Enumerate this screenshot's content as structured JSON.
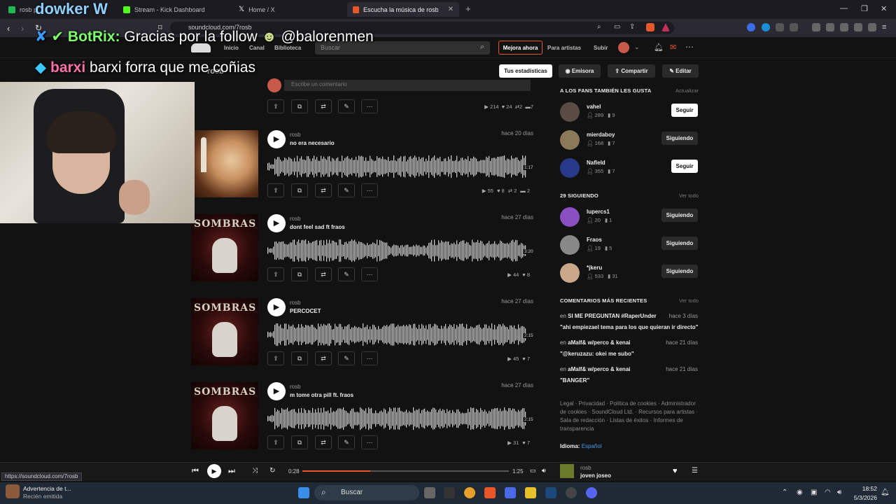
{
  "tabs": [
    {
      "label": "rosb p",
      "favicon_color": "#1db954"
    },
    {
      "label": "Stream - Kick Dashboard",
      "favicon_color": "#53fc18"
    },
    {
      "label": "Home / X",
      "favicon_color": "#ffffff"
    },
    {
      "label": "Escucha la música de rosb | Disfr",
      "favicon_color": "#e8572a"
    }
  ],
  "url": "soundcloud.com/7rosb",
  "status_url": "https://soundcloud.com/7rosb",
  "header": {
    "nav": [
      "Inicio",
      "Canal",
      "Biblioteca"
    ],
    "search_placeholder": "Buscar",
    "mejora": "Mejora ahora",
    "para_artistas": "Para artistas",
    "subir": "Subir"
  },
  "overlay": {
    "brand": "dowker W",
    "chat": [
      {
        "user": "BotRix:",
        "user_color": "#7cff6b",
        "text": " Gracias por la follow ",
        "mention": "@balorenmen"
      },
      {
        "user": "barxi",
        "user_color": "#ff6fa8",
        "text": " barxi forra que me coñias",
        "mention": ""
      }
    ]
  },
  "profile": {
    "name": "rosb",
    "actions": [
      "Tus estadísticas",
      "Emisora",
      "Compartir",
      "Editar"
    ]
  },
  "comment_placeholder": "Escribe un comentario",
  "first_row_stats": {
    "plays": "214",
    "likes": "24",
    "reposts": "2",
    "comments": "7"
  },
  "tracks": [
    {
      "user": "rosb",
      "title": "no era necesario",
      "date": "hace 20 días",
      "duration": "1:17",
      "plays": "55",
      "likes": "8",
      "reposts": "2",
      "comments": "2",
      "art": "girl"
    },
    {
      "user": "rosb",
      "title": "dont feel sad ft fraos",
      "date": "hace 27 días",
      "duration": "3:20",
      "plays": "44",
      "likes": "8",
      "reposts": "",
      "comments": "",
      "art": "sombras"
    },
    {
      "user": "rosb",
      "title": "PERCOCET",
      "date": "hace 27 días",
      "duration": "2:15",
      "plays": "45",
      "likes": "7",
      "reposts": "",
      "comments": "",
      "art": "sombras"
    },
    {
      "user": "rosb",
      "title": "m tome otra pill ft. fraos",
      "date": "hace 27 días",
      "duration": "2:15",
      "plays": "31",
      "likes": "7",
      "reposts": "",
      "comments": "",
      "art": "sombras"
    }
  ],
  "sidebar": {
    "fans_heading": "A LOS FANS TAMBIÉN LES GUSTA",
    "fans_link": "Actualizar",
    "fans": [
      {
        "name": "vahel",
        "followers": "289",
        "tracks": "9",
        "button": "Seguir",
        "color": "#5a4c44"
      },
      {
        "name": "mierdaboy",
        "followers": "168",
        "tracks": "7",
        "button": "Siguiendo",
        "color": "#8a7a5a"
      },
      {
        "name": "Nafleld",
        "followers": "355",
        "tracks": "7",
        "button": "Seguir",
        "color": "#2a3a8a"
      }
    ],
    "following_heading": "29 SIGUIENDO",
    "following_link": "Ver todo",
    "following": [
      {
        "name": "lupercs1",
        "followers": "20",
        "tracks": "1",
        "button": "Siguiendo",
        "color": "#8a4fc0"
      },
      {
        "name": "Fraos",
        "followers": "19",
        "tracks": "5",
        "button": "Siguiendo",
        "color": "#888888"
      },
      {
        "name": "*jkeru",
        "followers": "533",
        "tracks": "31",
        "button": "Siguiendo",
        "color": "#c8a888"
      }
    ],
    "comments_heading": "COMENTARIOS MÁS RECIENTES",
    "comments_link": "Ver todo",
    "comments": [
      {
        "prefix": "en ",
        "track": "SI ME PREGUNTAN #RaperUnder",
        "ago": "hace 3 días",
        "text": "\"ahi empiezael tema para los que quieran ir directo\""
      },
      {
        "prefix": "en ",
        "track": "aMalf& w/perco & kenai",
        "ago": "hace 21 días",
        "text": "\"@keruzazu: okei me subo\""
      },
      {
        "prefix": "en ",
        "track": "aMalf& w/perco & kenai",
        "ago": "hace 21 días",
        "text": "\"BANGER\""
      }
    ],
    "legal": "Legal · Privacidad · Política de cookies · Administrador de cookies · SoundCloud Ltd. · Recursos para artistas · Sala de redacción · Listas de éxitos · Informes de transparencia",
    "idioma_label": "Idioma:",
    "idioma_value": "Español"
  },
  "player": {
    "elapsed": "0:28",
    "total": "1:25",
    "progress": 0.33,
    "artist": "rosb",
    "title": "joven joseo"
  },
  "taskbar": {
    "search": "Buscar",
    "notif_title": "Advertencia de t...",
    "notif_sub": "Recién emitida",
    "time": "18:52",
    "date": "5/3/2026"
  }
}
